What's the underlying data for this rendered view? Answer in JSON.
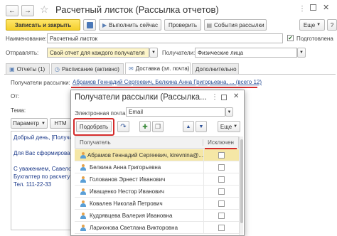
{
  "window": {
    "title": "Расчетный листок (Рассылка отчетов)",
    "icons": [
      "back-arrow-icon",
      "forward-arrow-icon",
      "favorite-star-icon"
    ]
  },
  "toolbar": {
    "save_close": "Записать и закрыть",
    "execute_now": "Выполнить сейчас",
    "check": "Проверить",
    "events": "События рассылки",
    "more": "Еще",
    "help": "?"
  },
  "form": {
    "name_label": "Наименование:",
    "name_value": "Расчетный листок",
    "prepared_label": "Подготовлена",
    "send_label": "Отправлять:",
    "send_value": "Свой отчет для каждого получателя",
    "recipients_label": "Получатели:",
    "recipients_value": "Физические лица"
  },
  "tabs": [
    {
      "label": "Отчеты (1)"
    },
    {
      "label": "Расписание (активно)"
    },
    {
      "label": "Доставка (эл. почта)"
    },
    {
      "label": "Дополнительно"
    }
  ],
  "delivery": {
    "recipients_label": "Получатели рассылки:",
    "recipients_link": "Абрамов Геннадий Сергеевич, Белкина Анна Григорьевна, ... (всего 12)",
    "from_label": "От:",
    "subject_label": "Тема:",
    "params_btn": "Параметр",
    "html_btn": "HTM",
    "body_lines": [
      "Добрый день, [Получатель]",
      "",
      "Для Вас сформирова",
      "",
      "С уважением, Савело",
      "Бухгалтер по расчету",
      "Тел. 111-22-33"
    ]
  },
  "dialog": {
    "title": "Получатели рассылки (Рассылка...",
    "email_label": "Электронная почта:",
    "email_value": "Email",
    "pick_btn": "Подобрать",
    "more_btn": "Еще",
    "col_recipient": "Получатель",
    "col_excluded": "Исключен",
    "rows": [
      {
        "name": "Абрамов Геннадий Сергеевич, kirevnina@..."
      },
      {
        "name": "Белкина Анна Григорьевна"
      },
      {
        "name": "Голованов Эрнест Иванович"
      },
      {
        "name": "Иващенко Нестор Иванович"
      },
      {
        "name": "Ковалев Николай Петрович"
      },
      {
        "name": "Кудрявцева Валерия Ивановна"
      },
      {
        "name": "Ларионова Светлана Викторовна"
      }
    ]
  }
}
